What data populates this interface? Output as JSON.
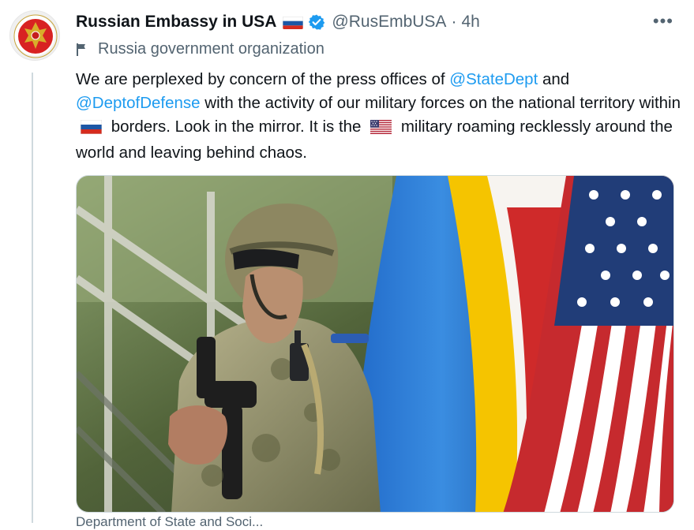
{
  "tweet": {
    "author_name": "Russian Embassy in USA",
    "handle": "@RusEmbUSA",
    "separator": "·",
    "time": "4h",
    "more_label": "•••",
    "affiliation": "Russia government organization",
    "text": {
      "p1": "We are perplexed by concern of the press offices of ",
      "mention1": "@StateDept",
      "p2": " and ",
      "mention2": "@DeptofDefense",
      "p3": " with the activity of our military forces on the national territory within ",
      "p4": " borders. Look in the mirror. It is the ",
      "p5": " military roaming recklessly around the world and leaving behind chaos."
    },
    "bottom_text": "Department of State and Soci..."
  },
  "icons": {
    "verified": "verified-badge-icon",
    "flag_ru": "russia-flag-emoji",
    "flag_us": "us-flag-emoji",
    "affiliation": "flag-icon",
    "more": "more-horizontal-icon"
  },
  "colors": {
    "accent": "#1d9bf0",
    "secondary": "#536471",
    "text": "#0f1419"
  }
}
